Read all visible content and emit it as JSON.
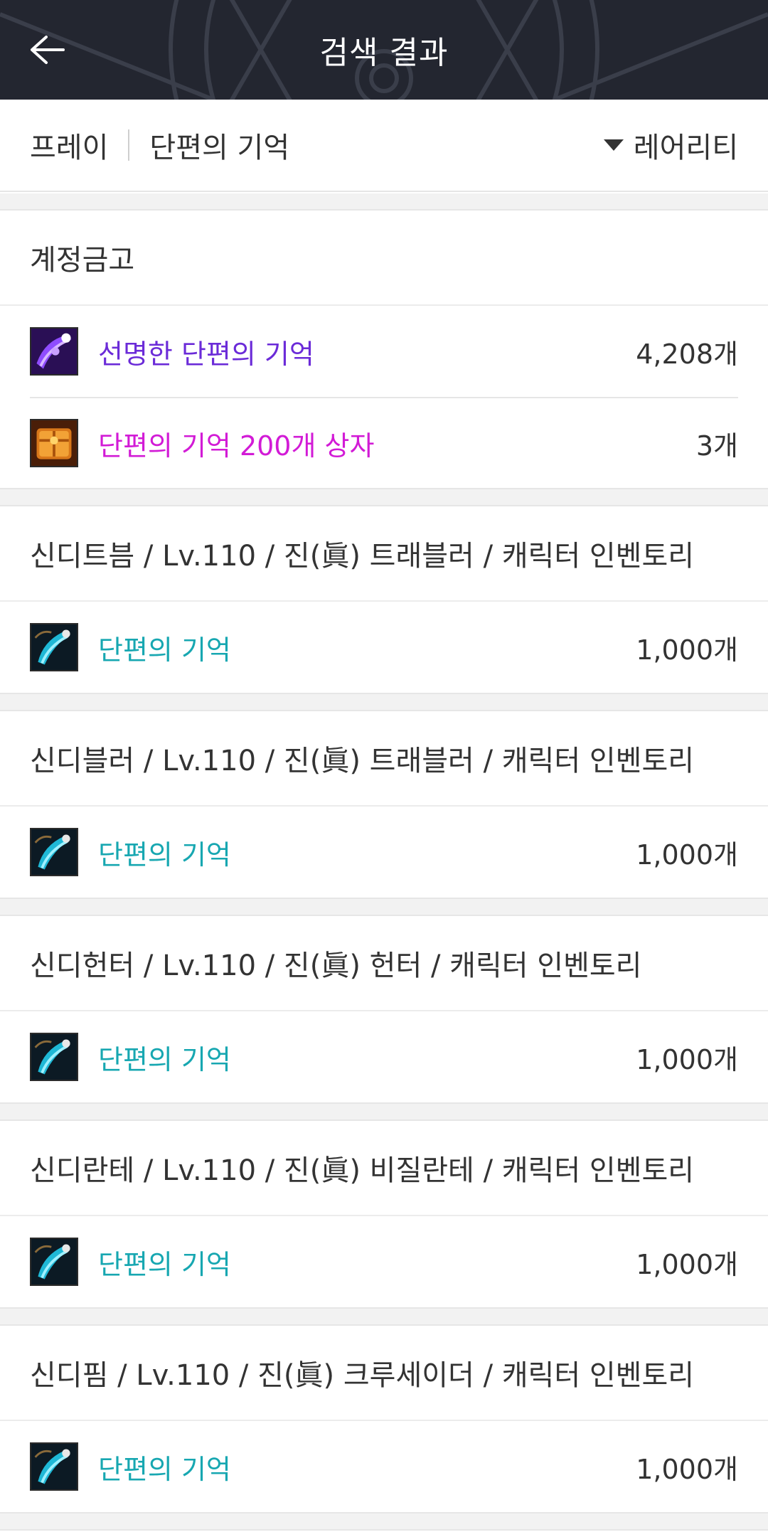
{
  "header": {
    "title": "검색 결과"
  },
  "filter": {
    "server": "프레이",
    "keyword": "단편의 기억",
    "sort_label": "레어리티"
  },
  "sections": [
    {
      "title": "계정금고",
      "items": [
        {
          "name": "선명한 단편의 기억",
          "qty": "4,208개",
          "rarity_color": "#6b2bd8",
          "icon": "vivid-fragment-memory-icon"
        },
        {
          "name": "단편의 기억 200개 상자",
          "qty": "3개",
          "rarity_color": "#d21bd6",
          "icon": "treasure-box-icon"
        }
      ]
    },
    {
      "title": "신디트븜 / Lv.110 / 진(眞) 트래블러 / 캐릭터 인벤토리",
      "items": [
        {
          "name": "단편의 기억",
          "qty": "1,000개",
          "rarity_color": "#17a7b1",
          "icon": "fragment-memory-icon"
        }
      ]
    },
    {
      "title": "신디블러 / Lv.110 / 진(眞) 트래블러 / 캐릭터 인벤토리",
      "items": [
        {
          "name": "단편의 기억",
          "qty": "1,000개",
          "rarity_color": "#17a7b1",
          "icon": "fragment-memory-icon"
        }
      ]
    },
    {
      "title": "신디헌터 / Lv.110 / 진(眞) 헌터 / 캐릭터 인벤토리",
      "items": [
        {
          "name": "단편의 기억",
          "qty": "1,000개",
          "rarity_color": "#17a7b1",
          "icon": "fragment-memory-icon"
        }
      ]
    },
    {
      "title": "신디란테 / Lv.110 / 진(眞) 비질란테 / 캐릭터 인벤토리",
      "items": [
        {
          "name": "단편의 기억",
          "qty": "1,000개",
          "rarity_color": "#17a7b1",
          "icon": "fragment-memory-icon"
        }
      ]
    },
    {
      "title": "신디핌 / Lv.110 / 진(眞) 크루세이더 / 캐릭터 인벤토리",
      "items": [
        {
          "name": "단편의 기억",
          "qty": "1,000개",
          "rarity_color": "#17a7b1",
          "icon": "fragment-memory-icon"
        }
      ]
    }
  ]
}
